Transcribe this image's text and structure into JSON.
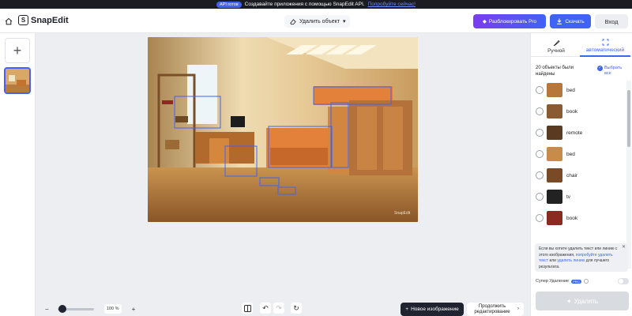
{
  "banner": {
    "pill": "API готов",
    "text": "Создавайте приложения с помощью SnapEdit API.",
    "link": "Попробуйте сейчас!"
  },
  "header": {
    "logo": "SnapEdit",
    "tool_select": "Удалить объект",
    "unlock_label": "Разблокировать Pro",
    "download_label": "Скачать",
    "login_label": "Вход"
  },
  "right_panel": {
    "tabs": [
      {
        "label": "Ручной"
      },
      {
        "label": "автоматический"
      }
    ],
    "found_text": "20 объекты были найдены",
    "select_all": "Выбрать все",
    "items": [
      {
        "label": "bed",
        "color": "#b7773a"
      },
      {
        "label": "book",
        "color": "#8a5a33"
      },
      {
        "label": "remote",
        "color": "#5b3a22"
      },
      {
        "label": "bed",
        "color": "#c98b4a"
      },
      {
        "label": "chair",
        "color": "#7a4a26"
      },
      {
        "label": "tv",
        "color": "#222222"
      },
      {
        "label": "book",
        "color": "#8b2a20"
      }
    ],
    "hint": {
      "text_before": "Если вы хотите удалить текст или линию с этого изображения,",
      "link1": "попробуйте удалить текст",
      "mid": "или",
      "link2": "удалить линию",
      "text_after": "для лучшего результата."
    },
    "super_remove": "Супер Удаление",
    "super_badge": "PRO",
    "remove_label": "Удалять"
  },
  "bottom": {
    "zoom": "100 %",
    "new_image": "Новое изображение",
    "continue_label": "Продолжить редактирование"
  },
  "colors": {
    "accent": "#3f63f5",
    "dark": "#1f2430"
  },
  "icons": {
    "home": "home-icon",
    "add": "plus-icon",
    "eraser": "eraser-icon",
    "download": "download-icon",
    "undo": "undo-icon",
    "redo": "redo-icon",
    "reset": "reset-icon",
    "compare": "compare-icon",
    "magic": "magic-wand-icon"
  }
}
